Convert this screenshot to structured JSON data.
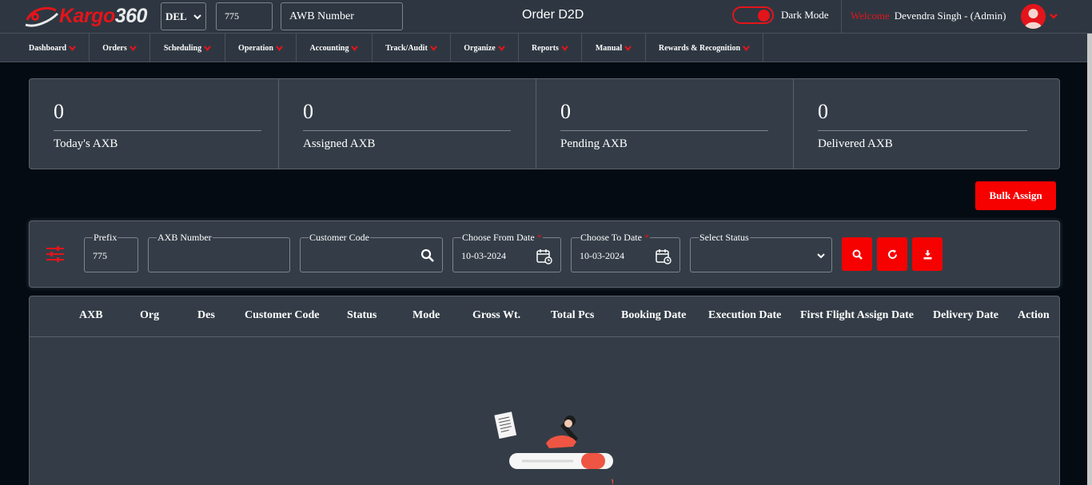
{
  "header": {
    "logo_text_prefix": "Kargo",
    "logo_text_suffix": "360",
    "station": "DEL",
    "prefix_value": "775",
    "awb_placeholder": "AWB Number",
    "page_title": "Order D2D",
    "dark_mode_label": "Dark Mode",
    "dark_mode_on": true,
    "welcome_label": "Welcome",
    "user_name": "Devendra Singh - (Admin)"
  },
  "nav": {
    "items": [
      {
        "label": "Dashboard"
      },
      {
        "label": "Orders"
      },
      {
        "label": "Scheduling"
      },
      {
        "label": "Operation"
      },
      {
        "label": "Accounting"
      },
      {
        "label": "Track/Audit"
      },
      {
        "label": "Organize"
      },
      {
        "label": "Reports"
      },
      {
        "label": "Manual"
      },
      {
        "label": "Rewards & Recognition"
      }
    ]
  },
  "stats": [
    {
      "value": "0",
      "label": "Today's AXB"
    },
    {
      "value": "0",
      "label": "Assigned AXB"
    },
    {
      "value": "0",
      "label": "Pending AXB"
    },
    {
      "value": "0",
      "label": "Delivered AXB"
    }
  ],
  "actions": {
    "bulk_assign": "Bulk Assign"
  },
  "filters": {
    "prefix_label": "Prefix",
    "prefix_value": "775",
    "axb_label": "AXB Number",
    "axb_value": "",
    "customer_label": "Customer Code",
    "customer_value": "",
    "from_label": "Choose From Date",
    "from_value": "10-03-2024",
    "to_label": "Choose To Date",
    "to_value": "10-03-2024",
    "required_mark": "*",
    "status_label": "Select Status",
    "status_value": ""
  },
  "table": {
    "columns": [
      "AXB",
      "Org",
      "Des",
      "Customer Code",
      "Status",
      "Mode",
      "Gross Wt.",
      "Total Pcs",
      "Booking Date",
      "Execution Date",
      "First Flight Assign Date",
      "Delivery Date",
      "Action"
    ],
    "rows": []
  },
  "colors": {
    "accent": "#f70000",
    "panel": "#343d47",
    "background": "#040b12",
    "header": "#2e3741"
  }
}
